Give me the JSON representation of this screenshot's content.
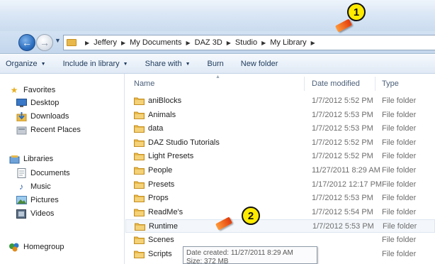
{
  "address": {
    "path": [
      "Jeffery",
      "My Documents",
      "DAZ 3D",
      "Studio",
      "My Library"
    ]
  },
  "toolbar": {
    "items": [
      "Organize",
      "Include in library",
      "Share with",
      "Burn",
      "New folder"
    ]
  },
  "nav": {
    "favorites_label": "Favorites",
    "favorites": [
      "Desktop",
      "Downloads",
      "Recent Places"
    ],
    "libraries_label": "Libraries",
    "libraries": [
      "Documents",
      "Music",
      "Pictures",
      "Videos"
    ],
    "homegroup_label": "Homegroup"
  },
  "columns": {
    "name": "Name",
    "date": "Date modified",
    "type": "Type"
  },
  "rows": [
    {
      "name": "aniBlocks",
      "date": "1/7/2012 5:52 PM",
      "type": "File folder"
    },
    {
      "name": "Animals",
      "date": "1/7/2012 5:53 PM",
      "type": "File folder"
    },
    {
      "name": "data",
      "date": "1/7/2012 5:53 PM",
      "type": "File folder"
    },
    {
      "name": "DAZ Studio Tutorials",
      "date": "1/7/2012 5:52 PM",
      "type": "File folder"
    },
    {
      "name": "Light Presets",
      "date": "1/7/2012 5:52 PM",
      "type": "File folder"
    },
    {
      "name": "People",
      "date": "11/27/2011 8:29 AM",
      "type": "File folder"
    },
    {
      "name": "Presets",
      "date": "1/17/2012 12:17 PM",
      "type": "File folder"
    },
    {
      "name": "Props",
      "date": "1/7/2012 5:53 PM",
      "type": "File folder"
    },
    {
      "name": "ReadMe's",
      "date": "1/7/2012 5:54 PM",
      "type": "File folder"
    },
    {
      "name": "Runtime",
      "date": "1/7/2012 5:53 PM",
      "type": "File folder"
    },
    {
      "name": "Scenes",
      "date": "",
      "type": "File folder"
    },
    {
      "name": "Scripts",
      "date": "",
      "type": "File folder"
    }
  ],
  "tooltip": {
    "line1": "Date created: 11/27/2011 8:29 AM",
    "line2": "Size: 372 MB"
  },
  "markers": [
    "1",
    "2"
  ],
  "icons": {
    "back": "back-arrow-icon",
    "forward": "forward-arrow-icon",
    "folder": "folder-icon",
    "star": "favorites-star-icon"
  },
  "colors": {
    "marker_fill": "#ffeb00",
    "pointer": "#e23a0a",
    "folder": "#e8b94a"
  }
}
